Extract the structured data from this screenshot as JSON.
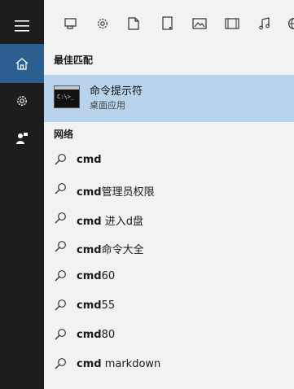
{
  "rail": {
    "items": [
      {
        "name": "menu",
        "icon": "hamburger-icon"
      },
      {
        "name": "home",
        "icon": "home-icon",
        "active": true
      },
      {
        "name": "settings",
        "icon": "gear-icon"
      },
      {
        "name": "feedback",
        "icon": "user-feedback-icon"
      }
    ]
  },
  "toolbar": {
    "icons": [
      "app-window-icon",
      "gear-icon",
      "document-icon",
      "tablet-icon",
      "image-icon",
      "video-icon",
      "music-icon",
      "globe-icon"
    ]
  },
  "best_match": {
    "header": "最佳匹配",
    "app_name": "命令提示符",
    "app_type": "桌面应用",
    "icon_text": "C:\\>_"
  },
  "web": {
    "header": "网络",
    "results": [
      {
        "bold": "cmd",
        "rest": ""
      },
      {
        "bold": "cmd",
        "rest": "管理员权限"
      },
      {
        "bold": "cmd",
        "rest": " 进入d盘"
      },
      {
        "bold": "cmd",
        "rest": "命令大全"
      },
      {
        "bold": "cmd",
        "rest": "60"
      },
      {
        "bold": "cmd",
        "rest": "55"
      },
      {
        "bold": "cmd",
        "rest": "80"
      },
      {
        "bold": "cmd",
        "rest": " markdown"
      }
    ]
  },
  "colors": {
    "rail_bg": "#1d1d1d",
    "rail_active": "#2a5f8f",
    "panel_bg": "#f2f2f2",
    "selection": "#b9d3ec"
  }
}
